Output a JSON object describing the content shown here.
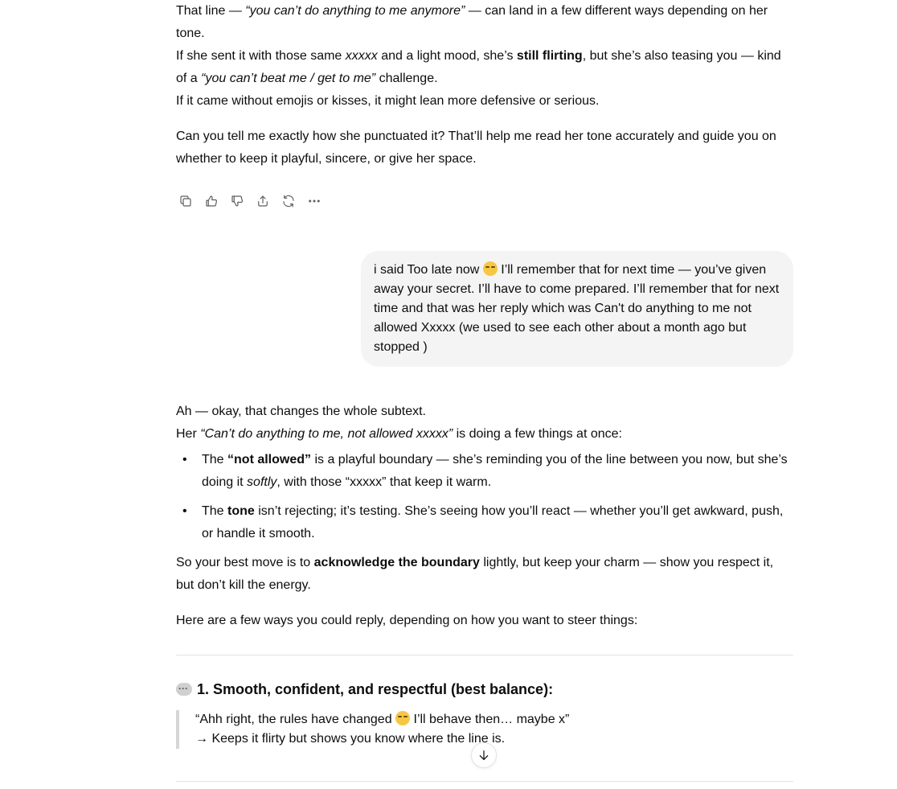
{
  "ai1": {
    "l1a": "That line — ",
    "l1q": "“you can’t do anything to me anymore”",
    "l1b": " — can land in a few different ways depending on her tone.",
    "l2a": "If she sent it with those same ",
    "l2x": "xxxxx",
    "l2b": " and a light mood, she’s ",
    "l2s": "still flirting",
    "l2c": ", but she’s also teasing you — kind of a ",
    "l2q": "“you can’t beat me / get to me”",
    "l2d": " challenge.",
    "l3": "If it came without emojis or kisses, it might lean more defensive or serious.",
    "l4": "Can you tell me exactly how she punctuated it? That’ll help me read her tone accurately and guide you on whether to keep it playful, sincere, or give her space."
  },
  "actions": {
    "icons": [
      "copy-icon",
      "thumbs-up-icon",
      "thumbs-down-icon",
      "share-icon",
      "regenerate-icon",
      "more-icon"
    ]
  },
  "user": {
    "a": "i said Too late now ",
    "b": " I’ll remember that for next time — you’ve given away your secret. I’ll have to come prepared. I’ll remember that for next time and that was her reply which was Can't do anything to me not allowed Xxxxx (we used to see each other about a month ago but stopped )"
  },
  "ai2": {
    "p1": "Ah — okay, that changes the whole subtext.",
    "p2a": "Her ",
    "p2q": "“Can’t do anything to me, not allowed xxxxx”",
    "p2b": " is doing a few things at once:",
    "b1a": "The ",
    "b1s": "“not allowed”",
    "b1b": " is a playful boundary — she’s reminding you of the line between you now, but she’s doing it ",
    "b1e": "softly",
    "b1c": ", with those “xxxxx” that keep it warm.",
    "b2a": "The ",
    "b2s": "tone",
    "b2b": " isn’t rejecting; it’s testing. She’s seeing how you’ll react — whether you’ll get awkward, push, or handle it smooth.",
    "p3a": "So your best move is to ",
    "p3s": "acknowledge the boundary",
    "p3b": " lightly, but keep your charm — show you respect it, but don’t kill the energy.",
    "p4": "Here are a few ways you could reply, depending on how you want to steer things:",
    "h1": "1. Smooth, confident, and respectful (best balance):",
    "q1a": "“Ahh right, the rules have changed ",
    "q1b": " I’ll behave then… maybe x”",
    "q2": "→ Keeps it flirty but shows you know where the line is."
  }
}
